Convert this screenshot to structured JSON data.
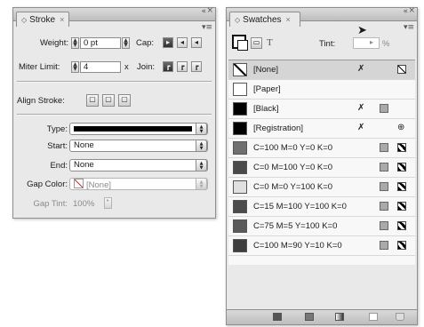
{
  "stroke": {
    "tab": "Stroke",
    "weight_label": "Weight:",
    "weight_value": "0 pt",
    "cap_label": "Cap:",
    "miter_label": "Miter Limit:",
    "miter_value": "4",
    "miter_unit": "x",
    "join_label": "Join:",
    "align_label": "Align Stroke:",
    "type_label": "Type:",
    "start_label": "Start:",
    "start_value": "None",
    "end_label": "End:",
    "end_value": "None",
    "gap_color_label": "Gap Color:",
    "gap_color_value": "[None]",
    "gap_tint_label": "Gap Tint:",
    "gap_tint_value": "100%"
  },
  "swatches": {
    "tab": "Swatches",
    "tint_label": "Tint:",
    "tint_unit": "%",
    "items": [
      {
        "name": "[None]",
        "chip": "none",
        "selected": true
      },
      {
        "name": "[Paper]",
        "chip": "#ffffff"
      },
      {
        "name": "[Black]",
        "chip": "#000000"
      },
      {
        "name": "[Registration]",
        "chip": "#000000"
      },
      {
        "name": "C=100 M=0 Y=0 K=0",
        "chip": "#6f6f6f"
      },
      {
        "name": "C=0 M=100 Y=0 K=0",
        "chip": "#4a4a4a"
      },
      {
        "name": "C=0 M=0 Y=100 K=0",
        "chip": "#e0e0e0"
      },
      {
        "name": "C=15 M=100 Y=100 K=0",
        "chip": "#4b4b4b"
      },
      {
        "name": "C=75 M=5 Y=100 K=0",
        "chip": "#5a5a5a"
      },
      {
        "name": "C=100 M=90 Y=10 K=0",
        "chip": "#3e3e3e"
      }
    ]
  }
}
